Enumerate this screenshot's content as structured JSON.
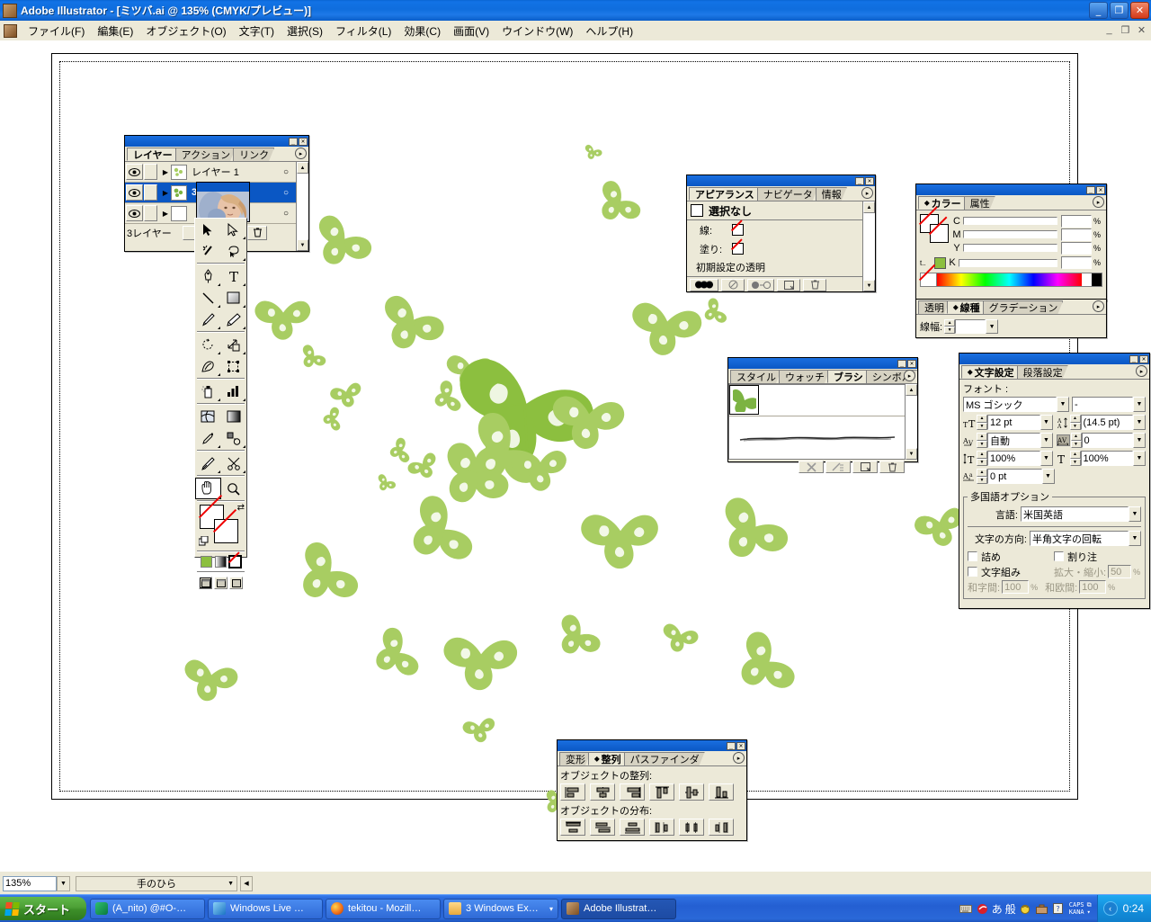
{
  "window": {
    "title": "Adobe Illustrator - [ミツバ.ai @ 135% (CMYK/プレビュー)]",
    "minimize": "_",
    "maximize": "❐",
    "close": "✕",
    "doc_minimize": "_",
    "doc_restore": "❐",
    "doc_close": "✕"
  },
  "menubar": {
    "items": [
      {
        "label": "ファイル(F)"
      },
      {
        "label": "編集(E)"
      },
      {
        "label": "オブジェクト(O)"
      },
      {
        "label": "文字(T)"
      },
      {
        "label": "選択(S)"
      },
      {
        "label": "フィルタ(L)"
      },
      {
        "label": "効果(C)"
      },
      {
        "label": "画面(V)"
      },
      {
        "label": "ウインドウ(W)"
      },
      {
        "label": "ヘルプ(H)"
      }
    ]
  },
  "statusbar": {
    "zoom": "135%",
    "zoom_arrow": "▼",
    "tool": "手のひら",
    "tool_arrow": "▼",
    "nav_arrow": "◀"
  },
  "taskbar": {
    "start": "スタート",
    "items": [
      {
        "label": "(A_nito) @#O-…",
        "active": false
      },
      {
        "label": "Windows Live …",
        "active": false
      },
      {
        "label": "tekitou - Mozill…",
        "active": false
      },
      {
        "label": "3 Windows Ex…",
        "active": false
      },
      {
        "label": "Adobe Illustrat…",
        "active": true
      }
    ],
    "group_arrow": "▾",
    "ime": {
      "mode_kana": "あ",
      "mode_width": "般",
      "caps": "CAPS",
      "kana": "KANA",
      "arrow": "▾"
    },
    "tray_arrow": "‹",
    "clock": "0:24"
  },
  "layers_panel": {
    "tabs": [
      {
        "label": "レイヤー",
        "active": true
      },
      {
        "label": "アクション",
        "active": false
      },
      {
        "label": "リンク",
        "active": false
      }
    ],
    "menu_icon": "▸",
    "rows": [
      {
        "name": "レイヤー 1",
        "target": "○",
        "selected": false
      },
      {
        "name": "3",
        "target": "○",
        "selected": true
      },
      {
        "name": "",
        "target": "○",
        "selected": false
      }
    ],
    "footer_count": "3レイヤー",
    "eye_icon": "eye-icon",
    "expand_icon": "▶"
  },
  "appearance_panel": {
    "tabs": [
      {
        "label": "アピアランス",
        "active": true
      },
      {
        "label": "ナビゲータ",
        "active": false
      },
      {
        "label": "情報",
        "active": false
      }
    ],
    "menu_icon": "▸",
    "heading": "選択なし",
    "rows": [
      {
        "label": "線:",
        "value": "none"
      },
      {
        "label": "塗り:",
        "value": "none"
      },
      {
        "label": "初期設定の透明",
        "value": ""
      }
    ]
  },
  "color_panel": {
    "tabs": [
      {
        "label": "カラー",
        "active": true
      },
      {
        "label": "属性",
        "active": false
      }
    ],
    "menu_icon": "▸",
    "channels": [
      {
        "label": "C",
        "value": ""
      },
      {
        "label": "M",
        "value": ""
      },
      {
        "label": "Y",
        "value": ""
      },
      {
        "label": "K",
        "value": ""
      }
    ],
    "percent": "%",
    "swatch_color": "#8cbf3f"
  },
  "stroke_panel": {
    "tabs": [
      {
        "label": "透明",
        "active": false
      },
      {
        "label": "線種",
        "active": true
      },
      {
        "label": "グラデーション",
        "active": false
      }
    ],
    "menu_icon": "▸",
    "weight_label": "線幅:",
    "weight_value": "",
    "arrow": "▼"
  },
  "brushes_panel": {
    "tabs": [
      {
        "label": "スタイル",
        "active": false
      },
      {
        "label": "ウォッチ",
        "active": false
      },
      {
        "label": "ブラシ",
        "active": true
      },
      {
        "label": "シンボル",
        "active": false
      }
    ],
    "menu_icon": "▸",
    "items": [
      "clover-brush",
      "charcoal-stroke"
    ],
    "footer_buttons": [
      "remove-brush-icon",
      "options-icon",
      "new-brush-icon",
      "delete-icon"
    ]
  },
  "character_panel": {
    "tabs": [
      {
        "label": "文字設定",
        "active": true
      },
      {
        "label": "段落設定",
        "active": false
      }
    ],
    "menu_icon": "▸",
    "font_label": "フォント :",
    "font_family": "MS ゴシック",
    "font_style": "-",
    "size_icon": "font-size-icon",
    "size": "12 pt",
    "leading_icon": "leading-icon",
    "leading": "(14.5 pt)",
    "kerning_icon": "kerning-icon",
    "kerning": "自動",
    "tracking_icon": "tracking-icon",
    "tracking": "0",
    "vscale_icon": "vertical-scale-icon",
    "vscale": "100%",
    "hscale_icon": "horizontal-scale-icon",
    "hscale": "100%",
    "baseline_icon": "baseline-shift-icon",
    "baseline": "0 pt",
    "multilingual_title": "多国語オプション",
    "language_label": "言語:",
    "language": "米国英語",
    "direction_label": "文字の方向:",
    "direction": "半角文字の回転",
    "cb_tsume": "詰め",
    "cb_warichu": "割り注",
    "cb_mojigumi": "文字組み",
    "scale_label": "拡大・縮小:",
    "scale_value": "50",
    "waji_label": "和字間:",
    "waji_value": "100",
    "waou_label": "和欧間:",
    "waou_value": "100",
    "percent": "%",
    "arrow": "▼"
  },
  "align_panel": {
    "tabs": [
      {
        "label": "変形",
        "active": false
      },
      {
        "label": "整列",
        "active": true
      },
      {
        "label": "パスファインダ",
        "active": false
      }
    ],
    "menu_icon": "▸",
    "align_title": "オブジェクトの整列:",
    "align_buttons": [
      "align-left-icon",
      "align-hcenter-icon",
      "align-right-icon",
      "align-top-icon",
      "align-vcenter-icon",
      "align-bottom-icon"
    ],
    "distribute_title": "オブジェクトの分布:",
    "distribute_buttons": [
      "distribute-top-icon",
      "distribute-vcenter-icon",
      "distribute-bottom-icon",
      "distribute-left-icon",
      "distribute-hcenter-icon",
      "distribute-right-icon"
    ]
  },
  "toolbox": {
    "tools": [
      {
        "name": "selection-tool",
        "sel": false,
        "corner": false
      },
      {
        "name": "direct-selection-tool",
        "sel": false,
        "corner": true
      },
      {
        "name": "magic-wand-tool",
        "sel": false,
        "corner": false
      },
      {
        "name": "lasso-tool",
        "sel": false,
        "corner": true
      },
      {
        "name": "pen-tool",
        "sel": false,
        "corner": true
      },
      {
        "name": "type-tool",
        "sel": false,
        "corner": true
      },
      {
        "name": "line-tool",
        "sel": false,
        "corner": true
      },
      {
        "name": "rectangle-tool",
        "sel": false,
        "corner": true
      },
      {
        "name": "paintbrush-tool",
        "sel": false,
        "corner": true
      },
      {
        "name": "pencil-tool",
        "sel": false,
        "corner": true
      },
      {
        "name": "rotate-tool",
        "sel": false,
        "corner": true
      },
      {
        "name": "scale-tool",
        "sel": false,
        "corner": true
      },
      {
        "name": "warp-tool",
        "sel": false,
        "corner": true
      },
      {
        "name": "free-transform-tool",
        "sel": false,
        "corner": false
      },
      {
        "name": "symbol-sprayer-tool",
        "sel": false,
        "corner": true
      },
      {
        "name": "column-graph-tool",
        "sel": false,
        "corner": true
      },
      {
        "name": "mesh-tool",
        "sel": false,
        "corner": false
      },
      {
        "name": "gradient-tool",
        "sel": false,
        "corner": false
      },
      {
        "name": "eyedropper-tool",
        "sel": false,
        "corner": true
      },
      {
        "name": "blend-tool",
        "sel": false,
        "corner": true
      },
      {
        "name": "slice-tool",
        "sel": false,
        "corner": true
      },
      {
        "name": "scissors-tool",
        "sel": false,
        "corner": true
      },
      {
        "name": "hand-tool",
        "sel": true,
        "corner": true
      },
      {
        "name": "zoom-tool",
        "sel": false,
        "corner": false
      }
    ],
    "fill_label": "fill-none-swatch",
    "stroke_label": "stroke-none-swatch",
    "swap_icon": "swap-fill-stroke-icon",
    "default_icon": "default-fill-stroke-icon",
    "color_mode_buttons": [
      "color-swatch",
      "gradient-swatch",
      "none-swatch"
    ],
    "screen_mode_buttons": [
      "standard-screen-icon",
      "full-screen-menubar-icon",
      "full-screen-icon"
    ],
    "active_color": "#8cbf3f"
  },
  "floating_image_window": {
    "name": "portrait-thumbnail-window"
  },
  "artwork": {
    "description": "clover-illustration",
    "color_light": "#a8cd62",
    "color_dark": "#8cbf3f"
  }
}
